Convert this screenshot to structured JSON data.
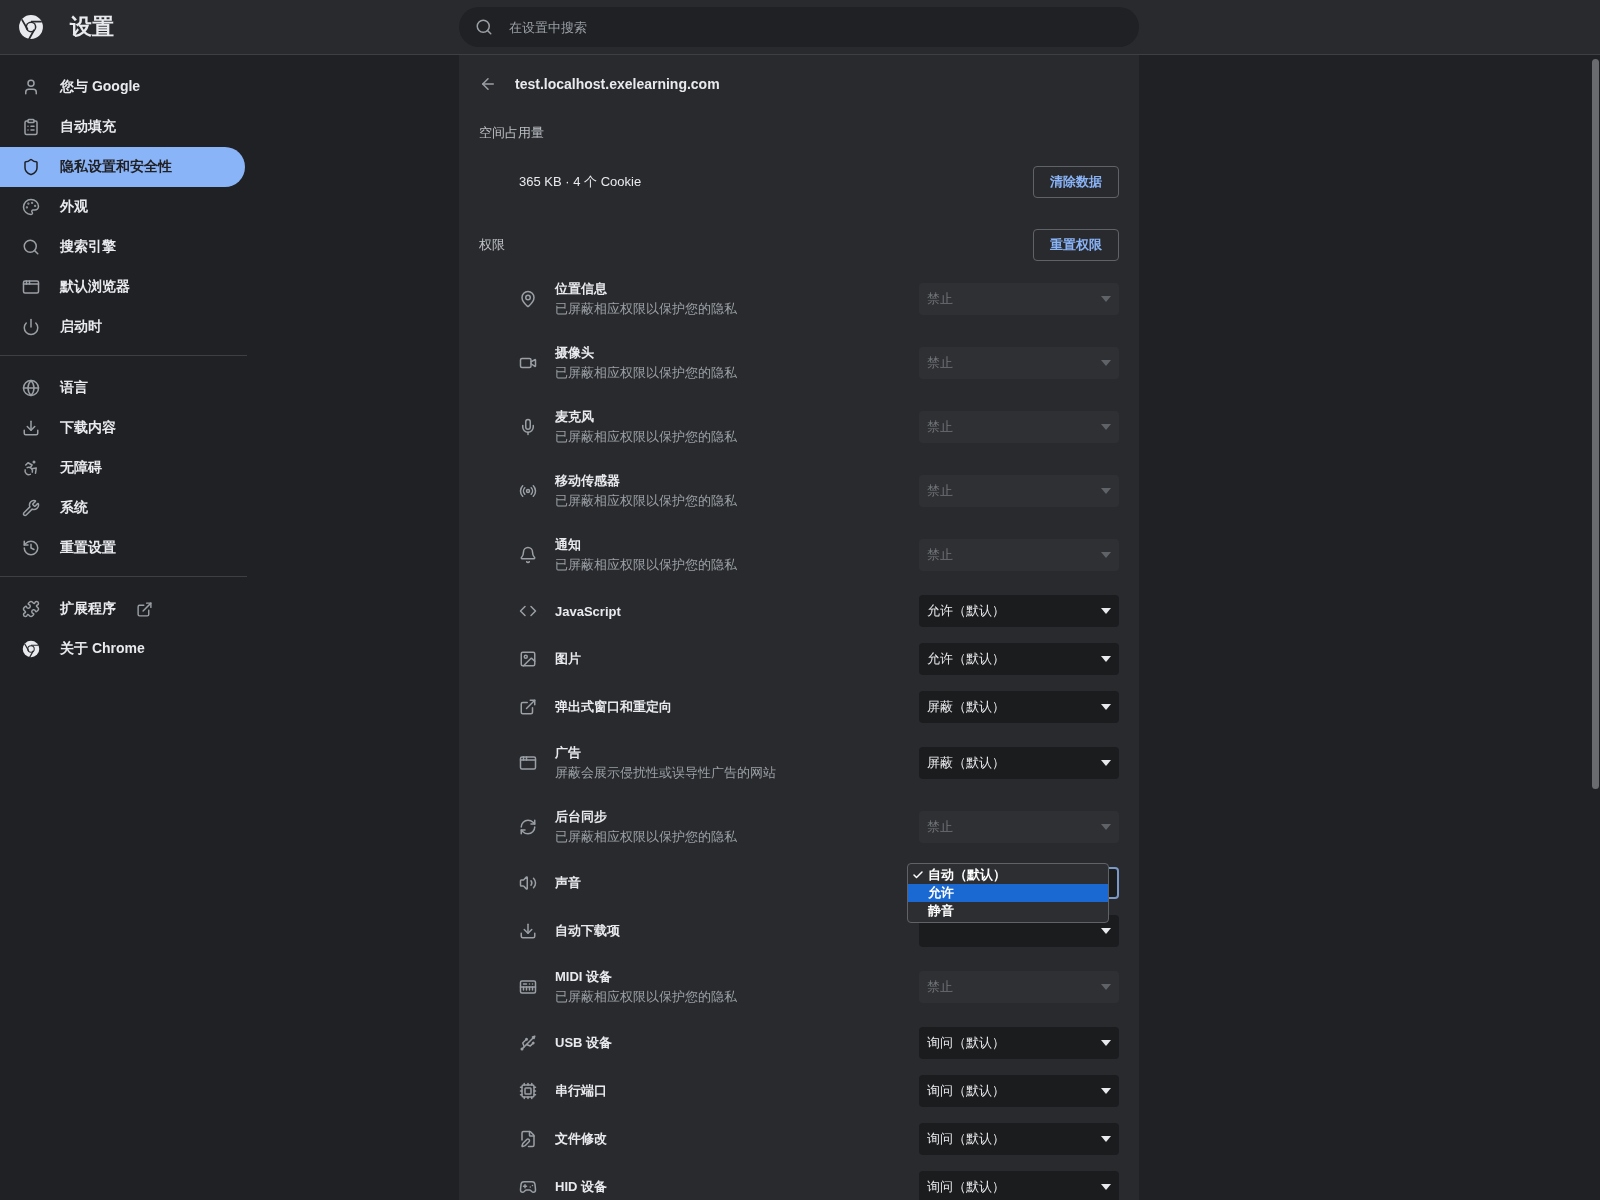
{
  "header": {
    "title": "设置",
    "search": {
      "placeholder": "在设置中搜索"
    }
  },
  "sidebar": {
    "groups": [
      [
        {
          "label": "您与 Google",
          "selected": false
        },
        {
          "label": "自动填充",
          "selected": false
        },
        {
          "label": "隐私设置和安全性",
          "selected": true
        },
        {
          "label": "外观",
          "selected": false
        },
        {
          "label": "搜索引擎",
          "selected": false
        },
        {
          "label": "默认浏览器",
          "selected": false
        },
        {
          "label": "启动时",
          "selected": false
        }
      ],
      [
        {
          "label": "语言",
          "selected": false
        },
        {
          "label": "下载内容",
          "selected": false
        },
        {
          "label": "无障碍",
          "selected": false
        },
        {
          "label": "系统",
          "selected": false
        },
        {
          "label": "重置设置",
          "selected": false
        }
      ],
      [
        {
          "label": "扩展程序",
          "selected": false,
          "external": true
        },
        {
          "label": "关于 Chrome",
          "selected": false,
          "external": false
        }
      ]
    ]
  },
  "site": {
    "title": "test.localhost.exelearning.com",
    "usage": {
      "heading": "空间占用量",
      "summary": "365 KB · 4 个 Cookie",
      "button": "清除数据"
    },
    "permissions": {
      "heading": "权限",
      "button": "重置权限",
      "rows": [
        {
          "title": "位置信息",
          "subtitle": "已屏蔽相应权限以保护您的隐私",
          "value": "禁止",
          "disabled": true
        },
        {
          "title": "摄像头",
          "subtitle": "已屏蔽相应权限以保护您的隐私",
          "value": "禁止",
          "disabled": true
        },
        {
          "title": "麦克风",
          "subtitle": "已屏蔽相应权限以保护您的隐私",
          "value": "禁止",
          "disabled": true
        },
        {
          "title": "移动传感器",
          "subtitle": "已屏蔽相应权限以保护您的隐私",
          "value": "禁止",
          "disabled": true
        },
        {
          "title": "通知",
          "subtitle": "已屏蔽相应权限以保护您的隐私",
          "value": "禁止",
          "disabled": true
        },
        {
          "title": "JavaScript",
          "value": "允许（默认）",
          "disabled": false
        },
        {
          "title": "图片",
          "value": "允许（默认）",
          "disabled": false
        },
        {
          "title": "弹出式窗口和重定向",
          "value": "屏蔽（默认）",
          "disabled": false
        },
        {
          "title": "广告",
          "subtitle": "屏蔽会展示侵扰性或误导性广告的网站",
          "value": "屏蔽（默认）",
          "disabled": false
        },
        {
          "title": "后台同步",
          "subtitle": "已屏蔽相应权限以保护您的隐私",
          "value": "禁止",
          "disabled": true
        },
        {
          "title": "声音",
          "disabled": false,
          "focused": true,
          "options": [
            {
              "label": "自动（默认）",
              "checked": true,
              "selected": false
            },
            {
              "label": "允许",
              "checked": false,
              "selected": true
            },
            {
              "label": "静音",
              "checked": false,
              "selected": false
            }
          ]
        },
        {
          "title": "自动下载项",
          "disabled": false
        },
        {
          "title": "MIDI 设备",
          "subtitle": "已屏蔽相应权限以保护您的隐私",
          "value": "禁止",
          "disabled": true
        },
        {
          "title": "USB 设备",
          "value": "询问（默认）",
          "disabled": false
        },
        {
          "title": "串行端口",
          "value": "询问（默认）",
          "disabled": false
        },
        {
          "title": "文件修改",
          "value": "询问（默认）",
          "disabled": false
        },
        {
          "title": "HID 设备",
          "value": "询问（默认）",
          "disabled": false
        }
      ]
    }
  }
}
